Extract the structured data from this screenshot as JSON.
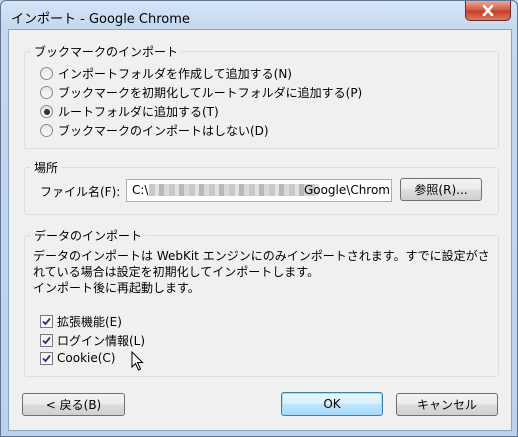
{
  "window": {
    "title": "インポート - Google Chrome"
  },
  "bookmarks": {
    "legend": "ブックマークのインポート",
    "options": [
      {
        "label": "インポートフォルダを作成して追加する(N)",
        "selected": false
      },
      {
        "label": "ブックマークを初期化してルートフォルダに追加する(P)",
        "selected": false
      },
      {
        "label": "ルートフォルダに追加する(T)",
        "selected": true
      },
      {
        "label": "ブックマークのインポートはしない(D)",
        "selected": false
      }
    ]
  },
  "location": {
    "legend": "場所",
    "file_label": "ファイル名(F):",
    "path_start": "C:\\",
    "path_end": "Google\\Chrom",
    "browse_button": "参照(R)..."
  },
  "data_import": {
    "legend": "データのインポート",
    "description_lines": [
      "データのインポートは WebKit エンジンにのみインポートされます。すでに設定がさ",
      "れている場合は設定を初期化してインポートします。",
      "インポート後に再起動します。"
    ],
    "items": [
      {
        "label": "拡張機能(E)",
        "checked": true
      },
      {
        "label": "ログイン情報(L)",
        "checked": true
      },
      {
        "label": "Cookie(C)",
        "checked": true
      }
    ]
  },
  "footer": {
    "back_button": "< 戻る(B)",
    "ok_button": "OK",
    "cancel_button": "キャンセル"
  }
}
